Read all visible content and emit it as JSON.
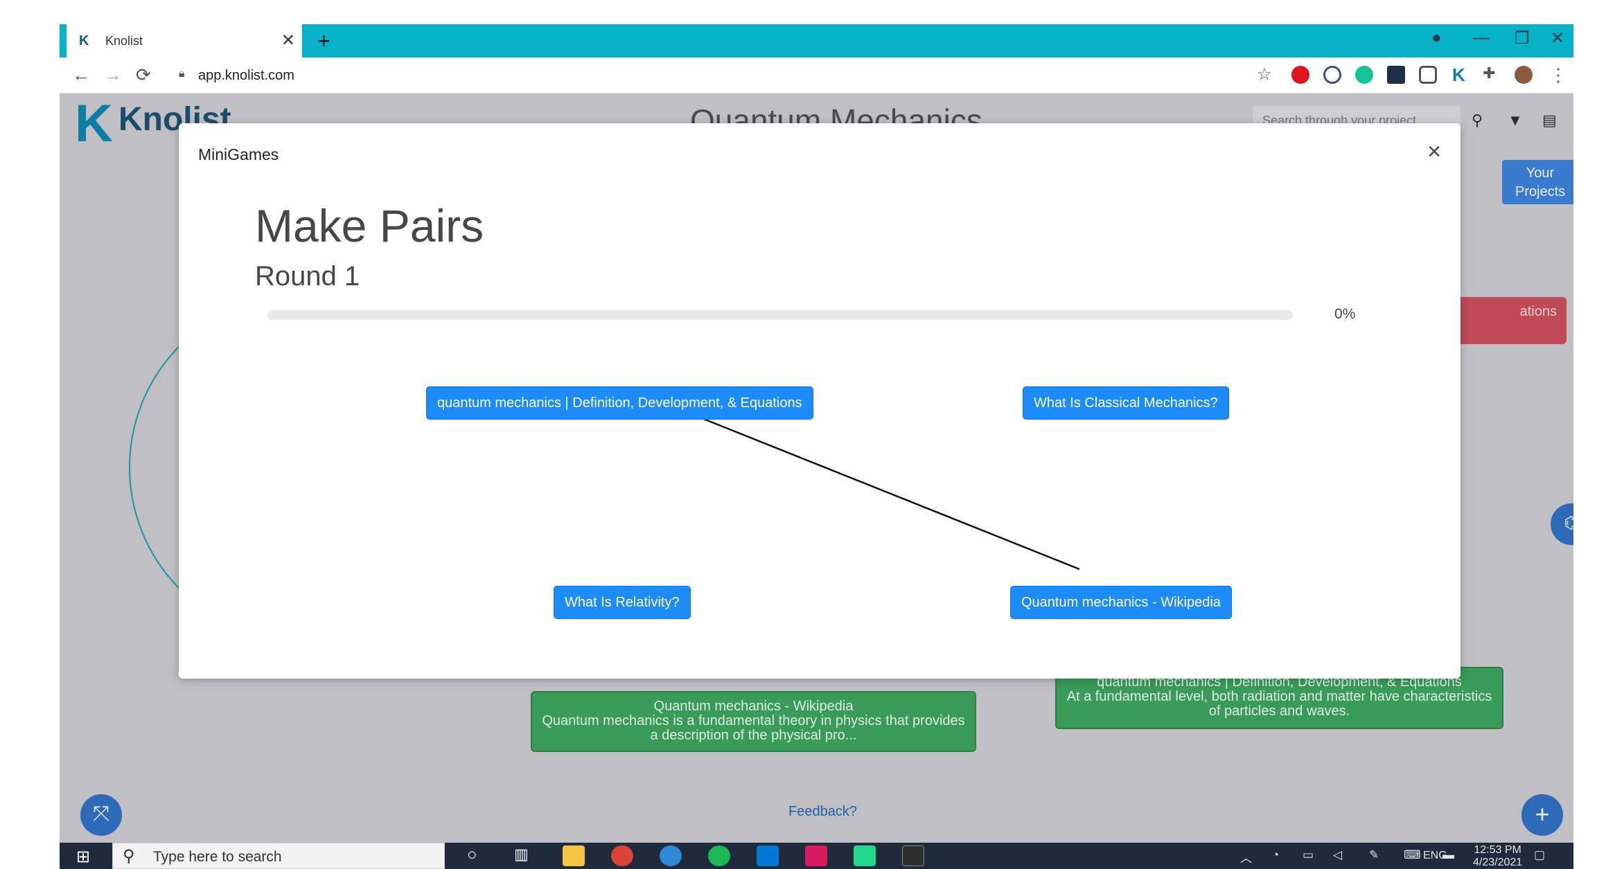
{
  "browser": {
    "tab_title": "Knolist",
    "tab_favicon": "K",
    "url": "app.knolist.com",
    "tab_close": "✕",
    "new_tab": "+"
  },
  "app": {
    "logo_letter": "K",
    "logo_text": "Knolist",
    "project_title": "Quantum Mechanics",
    "search_placeholder": "Search through your project",
    "your_projects": "Your Projects",
    "red_node_label": "ations",
    "green_node_left": {
      "title": "Quantum mechanics - Wikipedia",
      "snippet": "Quantum mechanics is a fundamental theory in physics that provides a description of the physical pro..."
    },
    "green_node_right": {
      "title": "quantum mechanics | Definition, Development, & Equations",
      "snippet": "At a fundamental level, both radiation and matter have characteristics of particles and waves."
    },
    "feedback": "Feedback?",
    "fab_add": "+",
    "fab_expand": "⤧"
  },
  "modal": {
    "header": "MiniGames",
    "close": "×",
    "game_title": "Make Pairs",
    "round": "Round 1",
    "progress": 0,
    "progress_label": "0%",
    "pair_buttons": [
      "quantum mechanics | Definition, Development, & Equations",
      "What Is Classical Mechanics?",
      "What Is Relativity?",
      "Quantum mechanics - Wikipedia"
    ]
  },
  "taskbar": {
    "search_text": "Type here to search",
    "lang": "ENG",
    "time": "12:53 PM",
    "date": "4/23/2021"
  },
  "colors": {
    "tab_accent": "#07b1c7",
    "pair_button": "#1d8cf8",
    "green_node": "#3a9a5a",
    "red_node": "#c04a56"
  }
}
